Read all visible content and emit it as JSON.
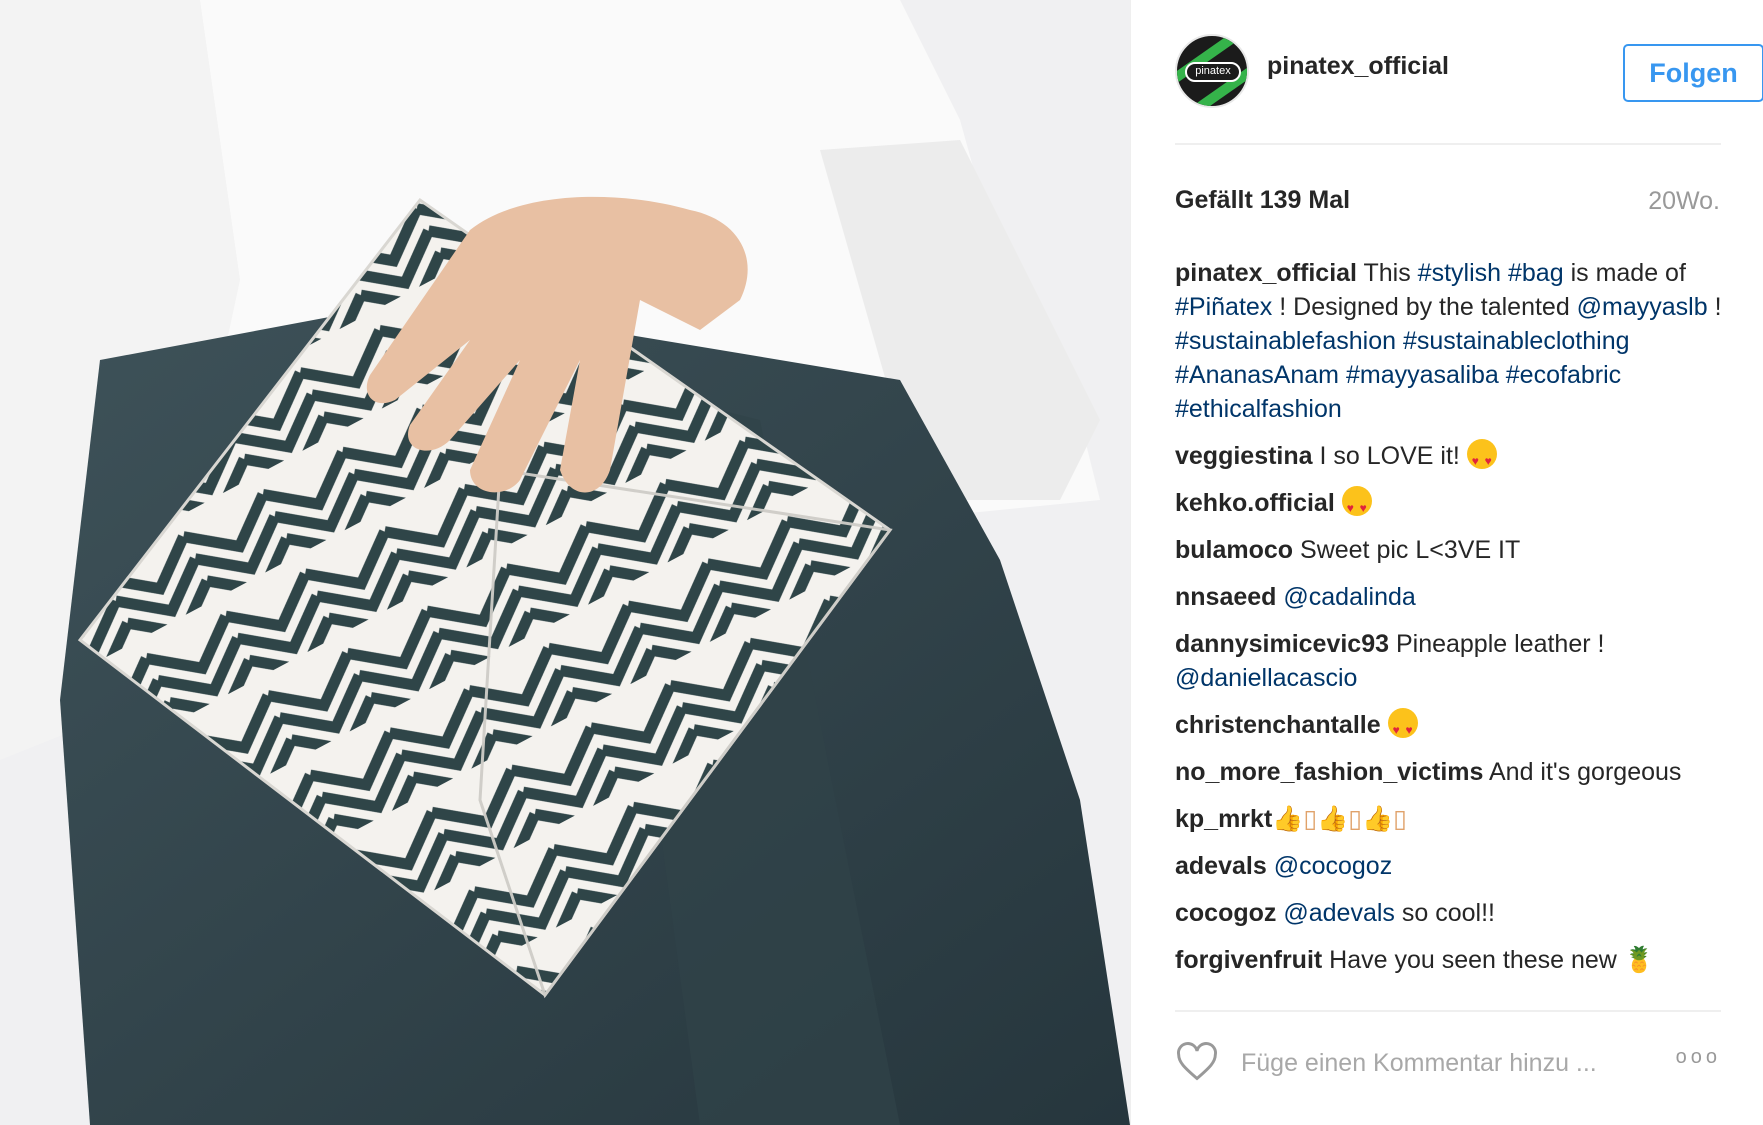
{
  "post": {
    "image_alt": "Person holding a white clutch bag with dark green chevron pattern",
    "account": {
      "username": "pinatex_official",
      "avatar_text": "pinatex"
    },
    "follow_label": "Folgen",
    "likes": "Gefällt 139 Mal",
    "age": "20Wo.",
    "caption": {
      "user": "pinatex_official",
      "t1": " This ",
      "h1": "#stylish",
      "t2": " ",
      "h2": "#bag",
      "t3": " is made of ",
      "h3": "#Piñatex",
      "t4": " ! Designed by the talented ",
      "m1": "@mayyaslb",
      "t5": " ! ",
      "h4": "#sustainablefashion",
      "t6": " ",
      "h5": "#sustainableclothing",
      "t7": " ",
      "h6": "#AnanasAnam",
      "t8": " ",
      "h7": "#mayyasaliba",
      "t9": " ",
      "h8": "#ecofabric",
      "t10": " ",
      "h9": "#ethicalfashion"
    },
    "comments": [
      {
        "user": "veggiestina",
        "text": " I so LOVE it! ",
        "emoji": "heart-eyes"
      },
      {
        "user": "kehko.official",
        "text": " ",
        "emoji": "heart-eyes"
      },
      {
        "user": "bulamoco",
        "text": " Sweet pic L<3VE IT"
      },
      {
        "user": "nnsaeed",
        "text": " ",
        "mention": "@cadalinda"
      },
      {
        "user": "dannysimicevic93",
        "text": " Pineapple leather ! ",
        "mention": "@daniellacascio"
      },
      {
        "user": "christenchantalle",
        "text": " ",
        "emoji": "heart-eyes"
      },
      {
        "user": "no_more_fashion_victims",
        "text": " And it's gorgeous"
      },
      {
        "user": "kp_mrkt",
        "text": " 👍▯👍▯👍▯"
      },
      {
        "user": "adevals",
        "text": " ",
        "mention": "@cocogoz"
      },
      {
        "user": "cocogoz",
        "text": " ",
        "mention": "@adevals",
        "after": " so cool!!"
      },
      {
        "user": "forgivenfruit",
        "text": " Have you seen these new 🍍"
      }
    ],
    "comment_placeholder": "Füge einen Kommentar hinzu ...",
    "more_label": "ooo"
  },
  "colors": {
    "accent": "#3897f0",
    "hashtag": "#003569",
    "text": "#262626",
    "muted": "#999999"
  }
}
